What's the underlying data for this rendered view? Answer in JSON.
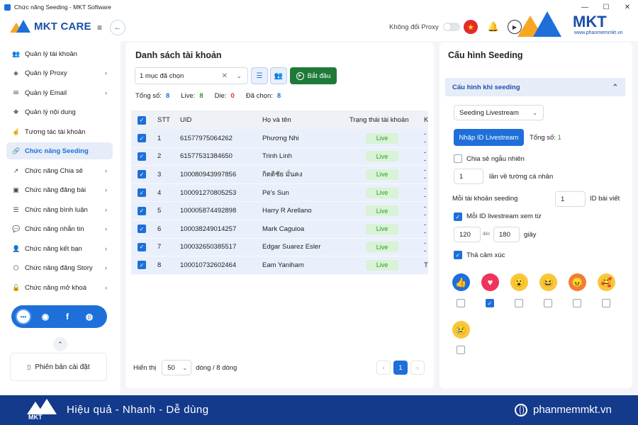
{
  "window": {
    "title": "Chức năng Seeding - MKT Software",
    "controls": [
      "—",
      "☐",
      "✕"
    ]
  },
  "header": {
    "logo_text": "MKT CARE",
    "proxy_label": "Không đổi Proxy",
    "brand_word": "MKT",
    "brand_site": "www.phanmemmkt.vn"
  },
  "sidebar": {
    "items": [
      {
        "label": "Quản lý tài khoản",
        "icon": "users-icon"
      },
      {
        "label": "Quản lý Proxy",
        "icon": "layers-icon"
      },
      {
        "label": "Quản lý Email",
        "icon": "mail-icon"
      },
      {
        "label": "Quản lý nội dung",
        "icon": "content-icon"
      },
      {
        "label": "Tương tác tài khoản",
        "icon": "tap-icon"
      },
      {
        "label": "Chức năng Seeding",
        "icon": "link-icon"
      },
      {
        "label": "Chức năng Chia sẻ",
        "icon": "share-icon"
      },
      {
        "label": "Chức năng đăng bài",
        "icon": "image-icon"
      },
      {
        "label": "Chức năng bình luận",
        "icon": "comment-icon"
      },
      {
        "label": "Chức năng nhắn tin",
        "icon": "message-icon"
      },
      {
        "label": "Chức năng kết bạn",
        "icon": "add-friend-icon"
      },
      {
        "label": "Chức năng đăng Story",
        "icon": "story-icon"
      },
      {
        "label": "Chức năng mở khoá",
        "icon": "unlock-icon"
      }
    ],
    "active_index": 5,
    "version_label": "Phiên bản cài đặt"
  },
  "main": {
    "title": "Danh sách tài khoản",
    "select_value": "1 mục đã chọn",
    "start_label": "Bắt đầu",
    "stats": {
      "total_label": "Tổng số:",
      "total": "8",
      "live_label": "Live:",
      "live": "8",
      "die_label": "Die:",
      "die": "0",
      "selected_label": "Đã chọn:",
      "selected": "8"
    },
    "columns": [
      "STT",
      "UID",
      "Họ và tên",
      "Trạng thái tài khoản",
      "K"
    ],
    "rows": [
      {
        "stt": "1",
        "uid": "61577975064262",
        "name": "Phương Nhi",
        "status": "Live",
        "extra": "--"
      },
      {
        "stt": "2",
        "uid": "61577531384650",
        "name": "Trinh Linh",
        "status": "Live",
        "extra": "--"
      },
      {
        "stt": "3",
        "uid": "100080943997856",
        "name": "กิตติชัย มั่นคง",
        "status": "Live",
        "extra": "--"
      },
      {
        "stt": "4",
        "uid": "100091270805253",
        "name": "Pè's Sun",
        "status": "Live",
        "extra": "--"
      },
      {
        "stt": "5",
        "uid": "100005874492898",
        "name": "Harry R Arellano",
        "status": "Live",
        "extra": "--"
      },
      {
        "stt": "6",
        "uid": "100038249014257",
        "name": "Mark Caguioa",
        "status": "Live",
        "extra": "--"
      },
      {
        "stt": "7",
        "uid": "100032650385517",
        "name": "Edgar Suarez Esler",
        "status": "Live",
        "extra": "--"
      },
      {
        "stt": "8",
        "uid": "100010732602464",
        "name": "Eam Yaniham",
        "status": "Live",
        "extra": "T"
      }
    ],
    "footer": {
      "show_label": "Hiển thị",
      "page_size": "50",
      "rows_label": "dòng / 8 dòng",
      "current_page": "1"
    }
  },
  "config": {
    "title": "Cấu hình Seeding",
    "section_title": "Cấu hình khi seeding",
    "mode_value": "Seeding Livestream",
    "import_btn": "Nhập ID Livestream",
    "total_label": "Tổng số:",
    "total": "1",
    "random_share_label": "Chia sẻ ngẫu nhiên",
    "share_times": "1",
    "share_times_label": "lần về tường cá nhân",
    "per_account_label": "Mỗi tài khoản seeding",
    "per_account_value": "1",
    "id_post_label": "ID bài viết",
    "watch_label": "Mỗi ID livestream xem từ",
    "watch_from": "120",
    "to_label": "đến",
    "watch_to": "180",
    "seconds_label": "giây",
    "react_label": "Thả cảm xúc",
    "reactions": [
      {
        "name": "like",
        "glyph": "👍",
        "checked": false
      },
      {
        "name": "love",
        "glyph": "♥",
        "checked": true
      },
      {
        "name": "wow",
        "glyph": "😮",
        "checked": false
      },
      {
        "name": "haha",
        "glyph": "😆",
        "checked": false
      },
      {
        "name": "angry",
        "glyph": "😠",
        "checked": false
      },
      {
        "name": "care",
        "glyph": "🥰",
        "checked": false
      },
      {
        "name": "sad",
        "glyph": "😢",
        "checked": false
      }
    ]
  },
  "banner": {
    "slogan": "Hiệu quả - Nhanh - Dễ dùng",
    "site": "phanmemmkt.vn",
    "logo_word": "MKT"
  }
}
